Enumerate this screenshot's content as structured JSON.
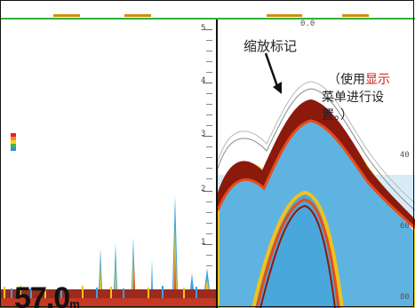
{
  "left_scale": {
    "labels": [
      "5",
      "4",
      "3",
      "2",
      "1"
    ]
  },
  "depth": {
    "value": "57.0",
    "unit": "m"
  },
  "zoom_marker_label": "缩放标记",
  "note": {
    "open": "（使用",
    "highlight": "显示",
    "line1_rest": "",
    "line2": "菜单进行设",
    "line3": "置。）"
  },
  "right_scale": {
    "top": "0.0",
    "mid": "40",
    "lower": "60",
    "bottom": "80"
  },
  "colors": {
    "frame": "#111111",
    "top_rule": "#2fae3a",
    "echo_strong": "#8b1a0c",
    "echo_mid": "#e84a1a",
    "echo_weak": "#f1c21a",
    "echo_faint": "#33a3dd",
    "highlight": "#cc1f1f"
  }
}
